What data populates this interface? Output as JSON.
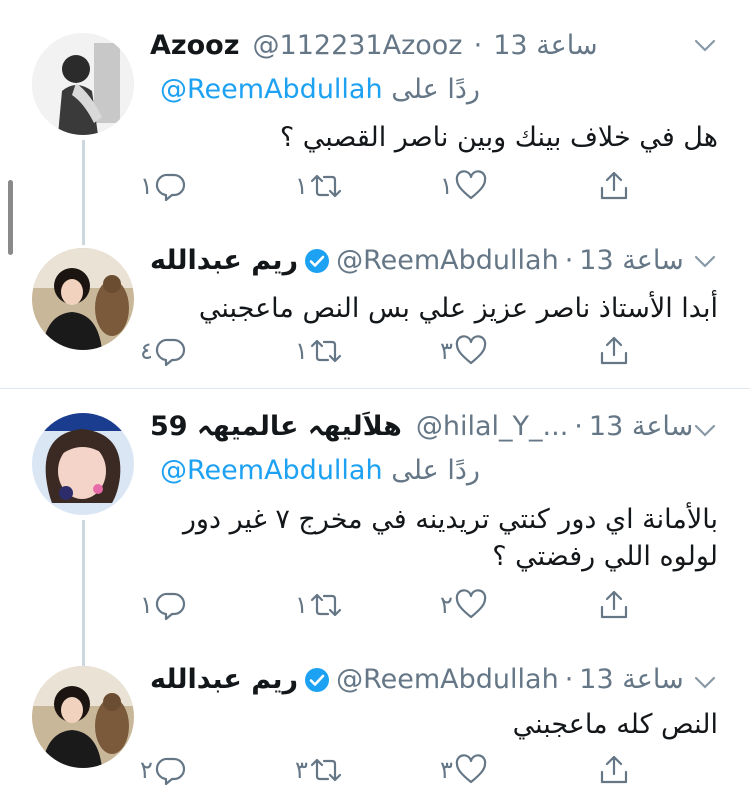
{
  "tweets": [
    {
      "name": "Azooz",
      "handle": "@112231Azooz",
      "time": "13 ساعة",
      "reply_label": "ردًا على",
      "reply_mention": "@ReemAbdullah",
      "text_lines": [
        "هل في خلاف بينك وبين ناصر القصبي ؟"
      ],
      "replies": "١",
      "retweets": "١",
      "likes": "١"
    },
    {
      "name": "ريم عبدالله",
      "handle": "@ReemAbdullah",
      "time": "13 ساعة",
      "text_lines": [
        "أبدا الأستاذ ناصر عزيز علي بس النص ماعجبني"
      ],
      "replies": "٤",
      "retweets": "١",
      "likes": "٣"
    },
    {
      "name": "هلاَليهہ عالميهہ 59",
      "handle": "@hilal_Y_...",
      "time": "13 ساعة",
      "reply_label": "ردًا على",
      "reply_mention": "@ReemAbdullah",
      "text_lines": [
        "بالأمانة اي دور كنتي تريدينه في مخرج ٧ غير دور",
        "لولوه اللي رفضتي ؟"
      ],
      "replies": "١",
      "retweets": "١",
      "likes": "٢"
    },
    {
      "name": "ريم عبدالله",
      "handle": "@ReemAbdullah",
      "time": "13 ساعة",
      "text_lines": [
        "النص كله ماعجبني"
      ],
      "replies": "٢",
      "retweets": "٣",
      "likes": "٣"
    }
  ],
  "colors": {
    "link": "#1da1f2",
    "muted": "#657786",
    "text": "#14171a",
    "divider": "#e1e8ed"
  },
  "icons": [
    "reply-icon",
    "retweet-icon",
    "like-icon",
    "share-icon",
    "verified-icon",
    "chevron-down-icon"
  ]
}
